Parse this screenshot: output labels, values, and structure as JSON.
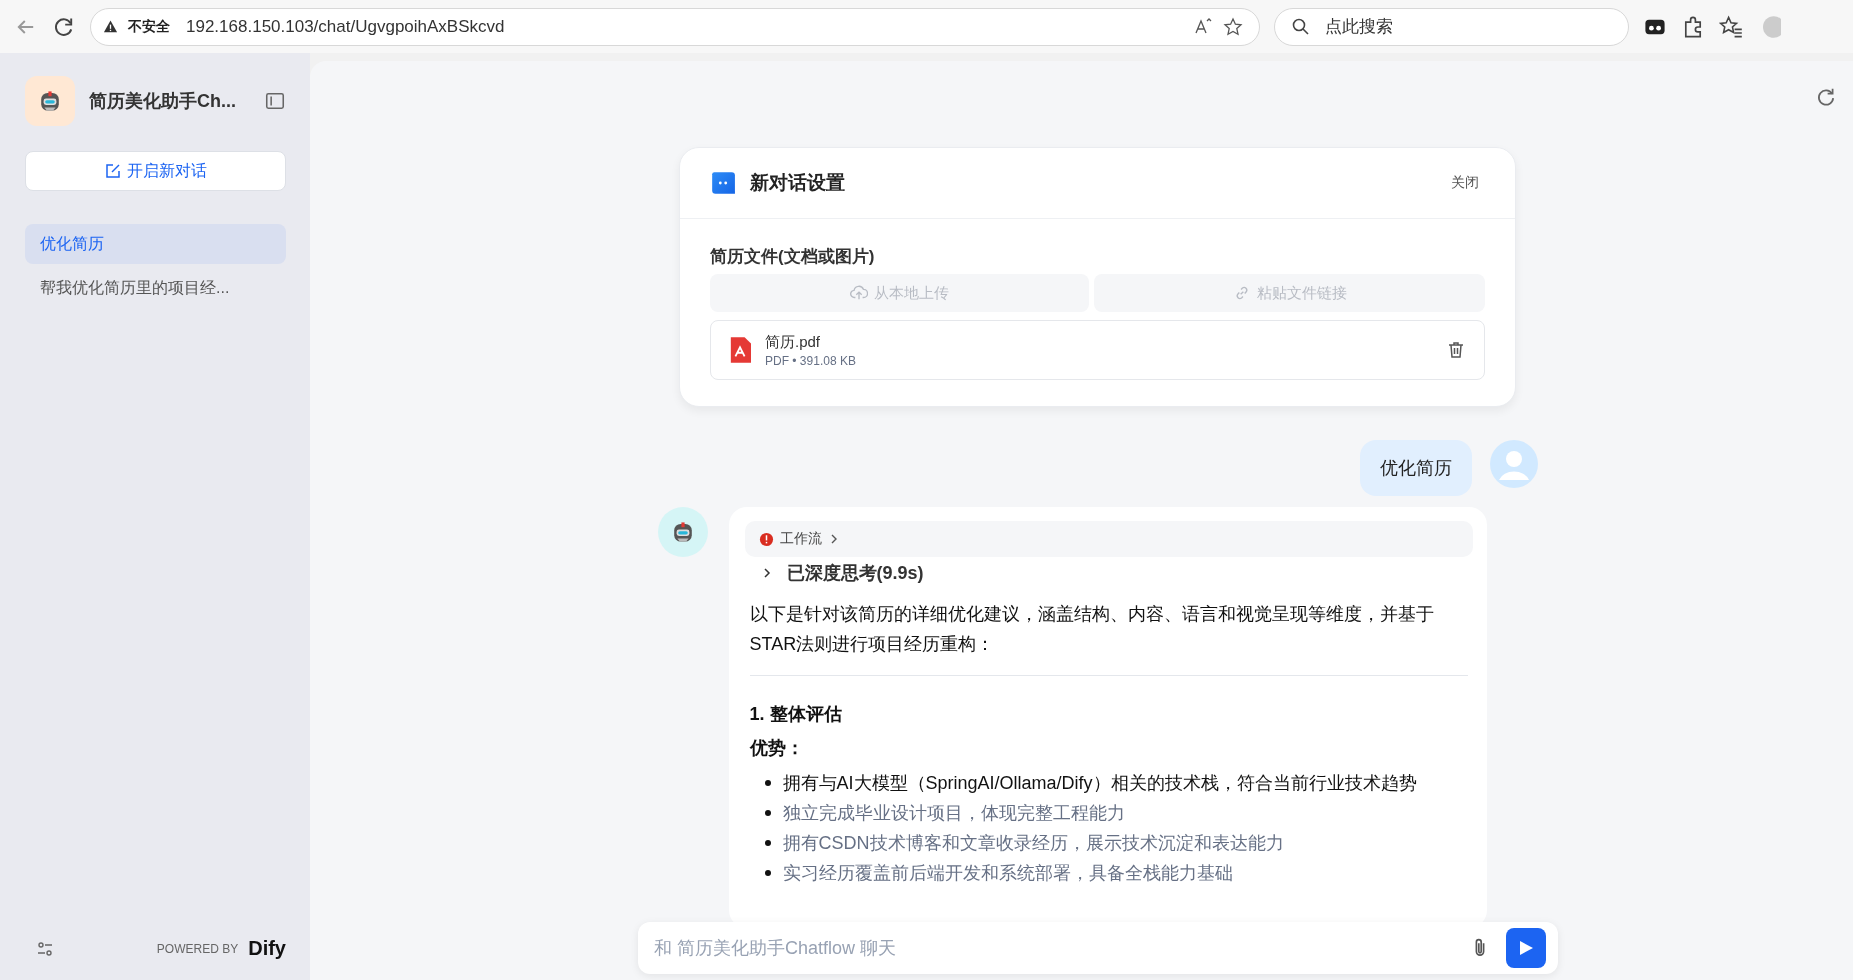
{
  "browser": {
    "security_label": "不安全",
    "url": "192.168.150.103/chat/UgvgpoihAxBSkcvd",
    "search_placeholder": "点此搜索"
  },
  "sidebar": {
    "app_name": "简历美化助手Ch...",
    "new_chat_button": "开启新对话",
    "conversations": [
      {
        "title": "优化简历",
        "selected": true
      },
      {
        "title": "帮我优化简历里的项目经...",
        "selected": false
      }
    ],
    "powered_by": "POWERED BY",
    "brand": "Dify"
  },
  "settings_card": {
    "title": "新对话设置",
    "close": "关闭",
    "field_label": "简历文件(文档或图片)",
    "upload_buttons": [
      {
        "label": "从本地上传",
        "kind": "upload",
        "disabled": true
      },
      {
        "label": "粘贴文件链接",
        "kind": "link",
        "disabled": true
      }
    ],
    "file": {
      "name": "简历.pdf",
      "type": "PDF",
      "separator": "•",
      "size": "391.08 KB"
    }
  },
  "messages": [
    {
      "kind": "user",
      "text": "优化简历"
    },
    {
      "kind": "assistant",
      "workflow": "工作流",
      "thinking": "已深度思考(9.9s)",
      "intro": "以下是针对该简历的详细优化建议，涵盖结构、内容、语言和视觉呈现等维度，并基于STAR法则进行项目经历重构：",
      "heading": "1. 整体评估",
      "subheading": "优势：",
      "bullets": [
        "拥有与AI大模型（SpringAI/Ollama/Dify）相关的技术栈，符合当前行业技术趋势",
        "独立完成毕业设计项目，体现完整工程能力",
        "拥有CSDN技术博客和文章收录经历，展示技术沉淀和表达能力",
        "实习经历覆盖前后端开发和系统部署，具备全栈能力基础"
      ]
    }
  ],
  "composer": {
    "placeholder": "和 简历美化助手Chatflow 聊天"
  }
}
